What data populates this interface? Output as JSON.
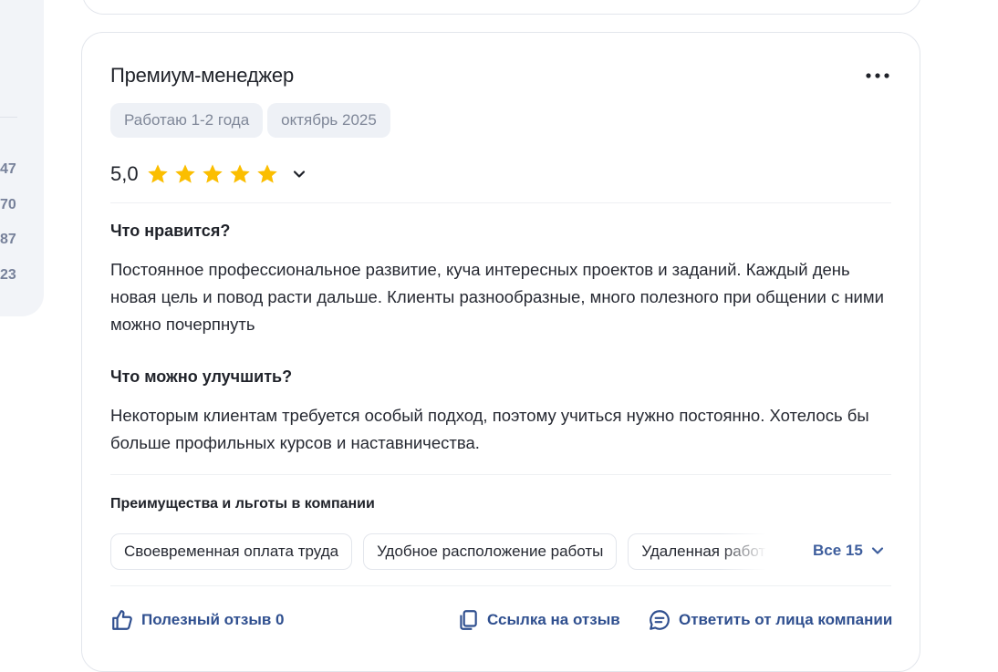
{
  "left_numbers": [
    "47",
    "70",
    "87",
    "23"
  ],
  "review": {
    "title": "Премиум-менеджер",
    "tags": [
      "Работаю 1-2 года",
      "октябрь 2025"
    ],
    "rating": "5,0",
    "stars": 5,
    "likes_title": "Что нравится?",
    "likes_text": "Постоянное профессиональное развитие, куча интересных проектов и заданий. Каждый день новая цель и повод расти дальше. Клиенты разнообразные, много полезного при общении с ними можно почерпнуть",
    "improve_title": "Что можно улучшить?",
    "improve_text": "Некоторым клиентам требуется особый подход, поэтому учиться нужно постоянно. Хотелось бы больше профильных курсов и наставничества.",
    "benefits_title": "Преимущества и льготы в компании",
    "benefits": [
      "Своевременная оплата труда",
      "Удобное расположение работы",
      "Удаленная работа"
    ],
    "all_benefits": "Все 15",
    "useful": "Полезный отзыв 0",
    "link": "Ссылка на отзыв",
    "reply": "Ответить от лица компании"
  },
  "colors": {
    "star": "#fbbe00",
    "accent": "#2f4f8f",
    "tag_bg": "#eef1f6"
  },
  "icons": [
    "more-icon",
    "star-icon",
    "chevron-down-icon",
    "thumbs-up-icon",
    "copy-link-icon",
    "reply-chat-icon"
  ]
}
